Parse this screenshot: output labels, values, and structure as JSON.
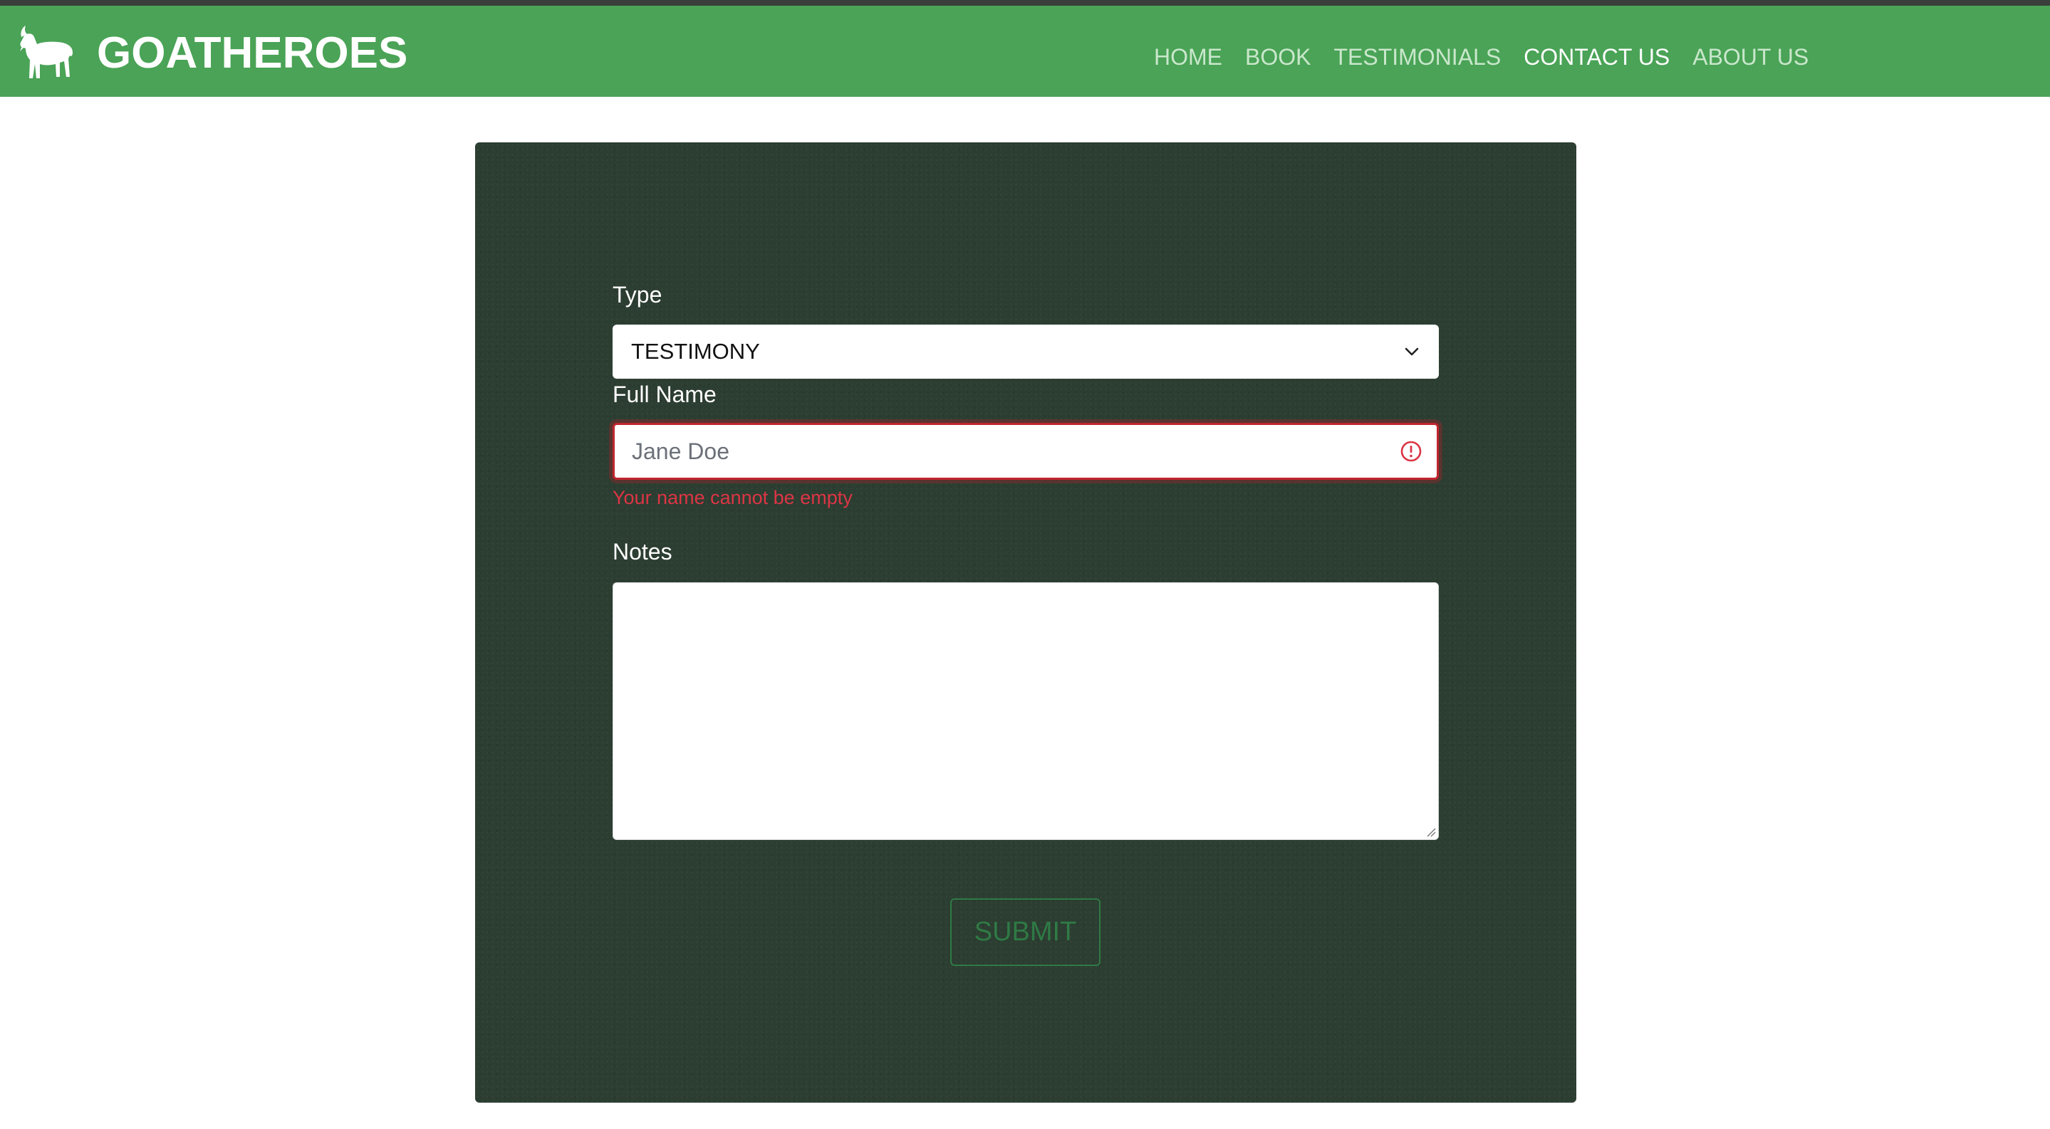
{
  "brand": {
    "name": "GOATHEROES",
    "logo_icon": "goat-icon"
  },
  "nav": {
    "items": [
      {
        "label": "HOME",
        "active": false
      },
      {
        "label": "BOOK",
        "active": false
      },
      {
        "label": "TESTIMONIALS",
        "active": false
      },
      {
        "label": "CONTACT US",
        "active": true
      },
      {
        "label": "ABOUT US",
        "active": false
      }
    ]
  },
  "form": {
    "type_label": "Type",
    "type_value": "TESTIMONY",
    "name_label": "Full Name",
    "name_placeholder": "Jane Doe",
    "name_value": "",
    "name_error": "Your name cannot be empty",
    "notes_label": "Notes",
    "notes_value": "",
    "submit_label": "SUBMIT"
  },
  "colors": {
    "navbar": "#4aa356",
    "panel": "#2c3d31",
    "error": "#dc3545",
    "submit": "#2f7a45"
  }
}
